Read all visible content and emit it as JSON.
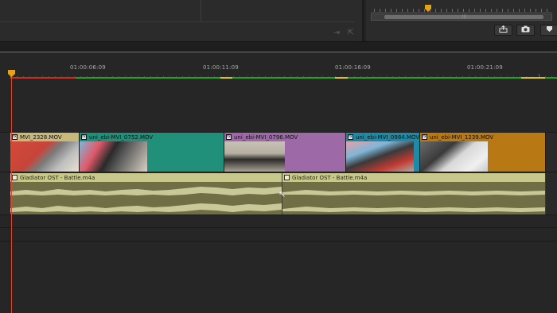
{
  "timeline": {
    "timecodes": [
      "01:00:06:09",
      "01:00:11:09",
      "01:00:16:09",
      "01:00:21:09"
    ]
  },
  "video_clips": [
    {
      "name": "MVI_2328.MOV",
      "color": "#c8b87a"
    },
    {
      "name": "uni_ebi-MVI_0752.MOV",
      "color": "#21907a"
    },
    {
      "name": "uni_ebi-MVI_0796.MOV",
      "color": "#9d6aa7"
    },
    {
      "name": "uni_ebi-MVI_0984.MOV",
      "color": "#1f8aa6"
    },
    {
      "name": "uni_ebi-MVI_1239.MOV",
      "color": "#b87814"
    }
  ],
  "audio_clips": [
    {
      "name": "Gladiator OST - Battle.m4a"
    },
    {
      "name": "Gladiator OST - Battle.m4a"
    }
  ],
  "icons": {
    "insert": "insert-icon",
    "overwrite": "overwrite-icon",
    "export": "export-frame-icon",
    "snapshot": "camera-icon",
    "marker": "marker-icon"
  },
  "colors": {
    "playhead": "#e3a21a",
    "render_red": "#d02a1d",
    "render_green": "#21a21e",
    "render_yellow": "#d3c12a",
    "audio_clip": "#7b7a4e"
  }
}
